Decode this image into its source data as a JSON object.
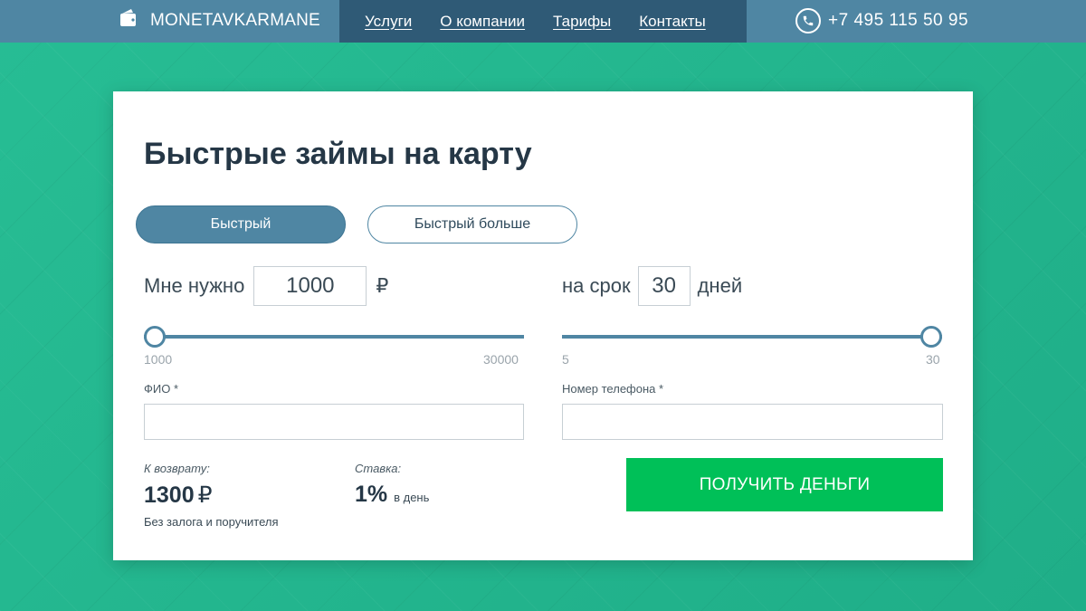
{
  "header": {
    "brand": "MONETAVKARMANE",
    "brand_icon": "wallet-icon",
    "nav": [
      {
        "label": "Услуги"
      },
      {
        "label": "О компании"
      },
      {
        "label": "Тарифы"
      },
      {
        "label": "Контакты"
      }
    ],
    "phone_icon": "phone-icon",
    "phone": "+7  495 115 50 95"
  },
  "card": {
    "title": "Быстрые займы на карту",
    "tabs": [
      {
        "label": "Быстрый",
        "active": true
      },
      {
        "label": "Быстрый больше",
        "active": false
      }
    ],
    "amount": {
      "prefix": "Мне нужно",
      "value": "1000",
      "currency": "₽",
      "min_label": "1000",
      "max_label": "30000",
      "slider_value": 1000,
      "slider_min": 1000,
      "slider_max": 30000
    },
    "term": {
      "prefix": "на срок",
      "value": "30",
      "suffix": "дней",
      "min_label": "5",
      "max_label": "30",
      "slider_value": 30,
      "slider_min": 5,
      "slider_max": 30
    },
    "fio": {
      "label": "ФИО *",
      "value": "",
      "placeholder": ""
    },
    "phone_field": {
      "label": "Номер телефона *",
      "value": "",
      "placeholder": ""
    },
    "repay": {
      "label": "К возврату:",
      "value": "1300",
      "currency": "₽"
    },
    "rate": {
      "label": "Ставка:",
      "value": "1%",
      "suffix": "в день"
    },
    "note": "Без залога и поручителя",
    "submit_label": "ПОЛУЧИТЬ ДЕНЬГИ"
  },
  "colors": {
    "background": "#22b38c",
    "header": "#4f86a3",
    "nav_bg": "#2f5a76",
    "accent": "#4f86a3",
    "cta": "#00c058"
  }
}
